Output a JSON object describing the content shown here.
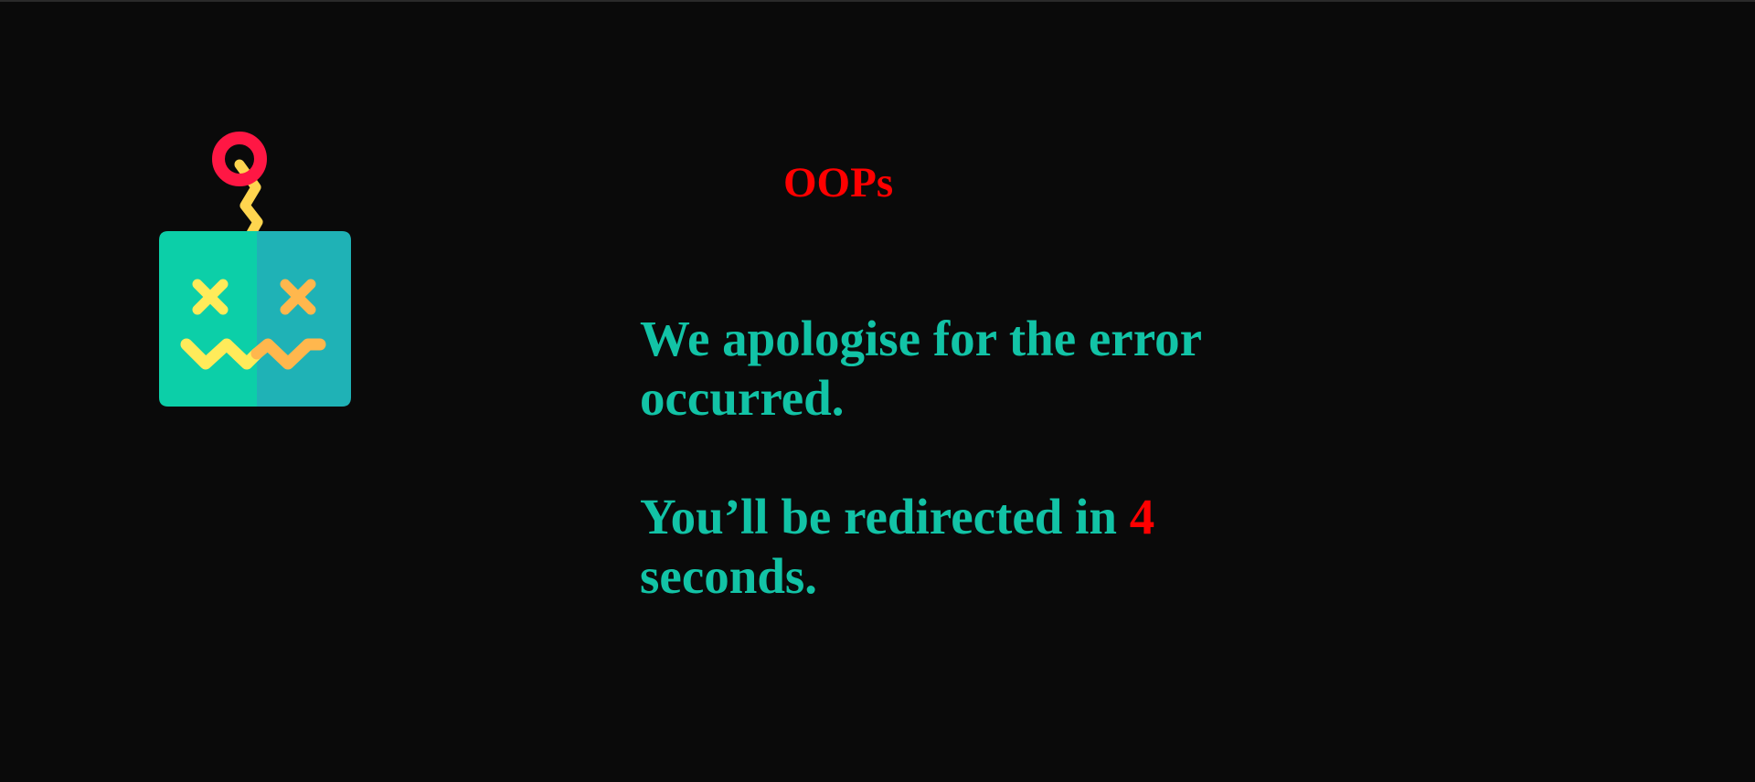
{
  "page": {
    "title": "OOPs",
    "message": "We apologise for the error occurred.",
    "redirect_prefix": "You’ll be redirected in ",
    "countdown": "4",
    "redirect_suffix": " seconds."
  },
  "icon": {
    "name": "broken-robot-icon",
    "colors": {
      "antenna_ring": "#ff1744",
      "antenna_wire": "#ffd54f",
      "head_left": "#0ccfa8",
      "head_right": "#1fb2b6",
      "features_left": "#ffeb5a",
      "features_right": "#ffb74d"
    }
  },
  "colors": {
    "background": "#0a0a0a",
    "title": "#ff0000",
    "text": "#12c3a6",
    "countdown": "#ff0000"
  }
}
